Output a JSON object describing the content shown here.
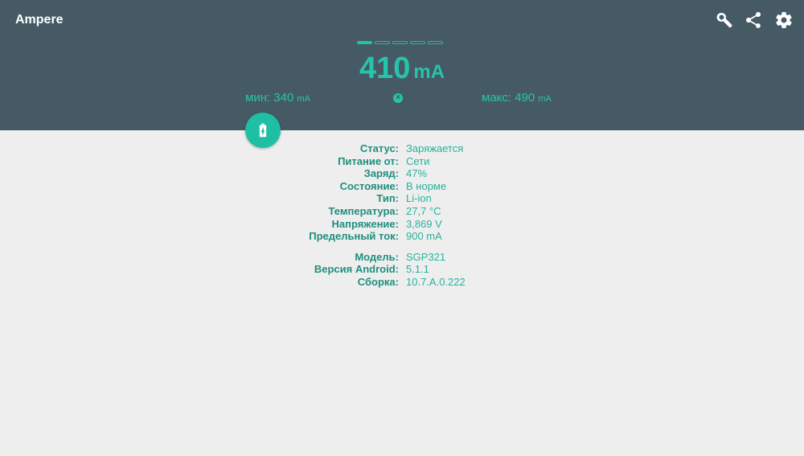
{
  "app": {
    "title": "Ampere"
  },
  "toolbar": {
    "icons": [
      "wrench-icon",
      "share-icon",
      "gear-icon"
    ]
  },
  "colors": {
    "header_bg": "#455a64",
    "accent": "#26c5ab",
    "label": "#1e8f7f",
    "background": "#eeeeee"
  },
  "indicators": {
    "count": 5,
    "active_index": 0
  },
  "reading": {
    "current_value": "410",
    "current_unit": "mA",
    "min_label": "мин: 340",
    "min_unit": "mA",
    "max_label": "макс: 490",
    "max_unit": "mA",
    "reset_symbol": "×"
  },
  "battery_info": [
    {
      "label": "Статус:",
      "value": "Заряжается"
    },
    {
      "label": "Питание от:",
      "value": "Сети"
    },
    {
      "label": "Заряд:",
      "value": "47%"
    },
    {
      "label": "Состояние:",
      "value": "В норме"
    },
    {
      "label": "Тип:",
      "value": "Li-ion"
    },
    {
      "label": "Температура:",
      "value": "27,7 °C"
    },
    {
      "label": "Напряжение:",
      "value": "3,869 V"
    },
    {
      "label": "Предельный ток:",
      "value": "900 mA"
    }
  ],
  "device_info": [
    {
      "label": "Модель:",
      "value": "SGP321"
    },
    {
      "label": "Версия Android:",
      "value": "5.1.1"
    },
    {
      "label": "Сборка:",
      "value": "10.7.A.0.222"
    }
  ]
}
